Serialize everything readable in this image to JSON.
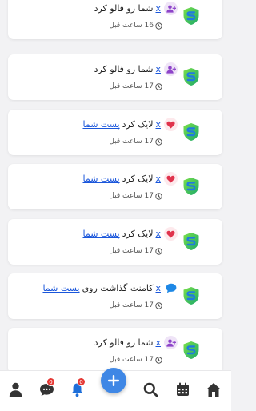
{
  "notifications": [
    {
      "type": "follow",
      "icon": "user-plus-icon",
      "user": "x",
      "text": "شما رو فالو کرد",
      "link": "",
      "time_num": "16",
      "time_text": "ساعت قبل"
    },
    {
      "type": "follow",
      "icon": "user-plus-icon",
      "user": "x",
      "text": "شما رو فالو کرد",
      "link": "",
      "time_num": "17",
      "time_text": "ساعت قبل"
    },
    {
      "type": "like",
      "icon": "heart-icon",
      "user": "x",
      "text": "لایک کرد",
      "link": "پست شما",
      "time_num": "17",
      "time_text": "ساعت قبل"
    },
    {
      "type": "like",
      "icon": "heart-icon",
      "user": "x",
      "text": "لایک کرد",
      "link": "پست شما",
      "time_num": "17",
      "time_text": "ساعت قبل"
    },
    {
      "type": "like",
      "icon": "heart-icon",
      "user": "x",
      "text": "لایک کرد",
      "link": "پست شما",
      "time_num": "17",
      "time_text": "ساعت قبل"
    },
    {
      "type": "comment",
      "icon": "chat-bubble-icon",
      "user": "x",
      "text": "کامنت گذاشت روی",
      "link": "پست شما",
      "time_num": "17",
      "time_text": "ساعت قبل"
    },
    {
      "type": "follow",
      "icon": "user-plus-icon",
      "user": "x",
      "text": "شما رو فالو کرد",
      "link": "",
      "time_num": "17",
      "time_text": "ساعت قبل"
    }
  ],
  "bottom_nav": {
    "items": [
      "home-icon",
      "calendar-icon",
      "search-icon",
      "add-post-button",
      "notifications-bell-icon",
      "messages-icon",
      "profile-icon"
    ],
    "notifications_badge": "0",
    "messages_badge": "0"
  },
  "colors": {
    "link": "#1a56db",
    "fab": "#3f87e5",
    "badge": "#e53935",
    "follow_icon": "#8e44c9",
    "like_icon": "#e0334c",
    "comment_icon": "#1e88e5"
  }
}
